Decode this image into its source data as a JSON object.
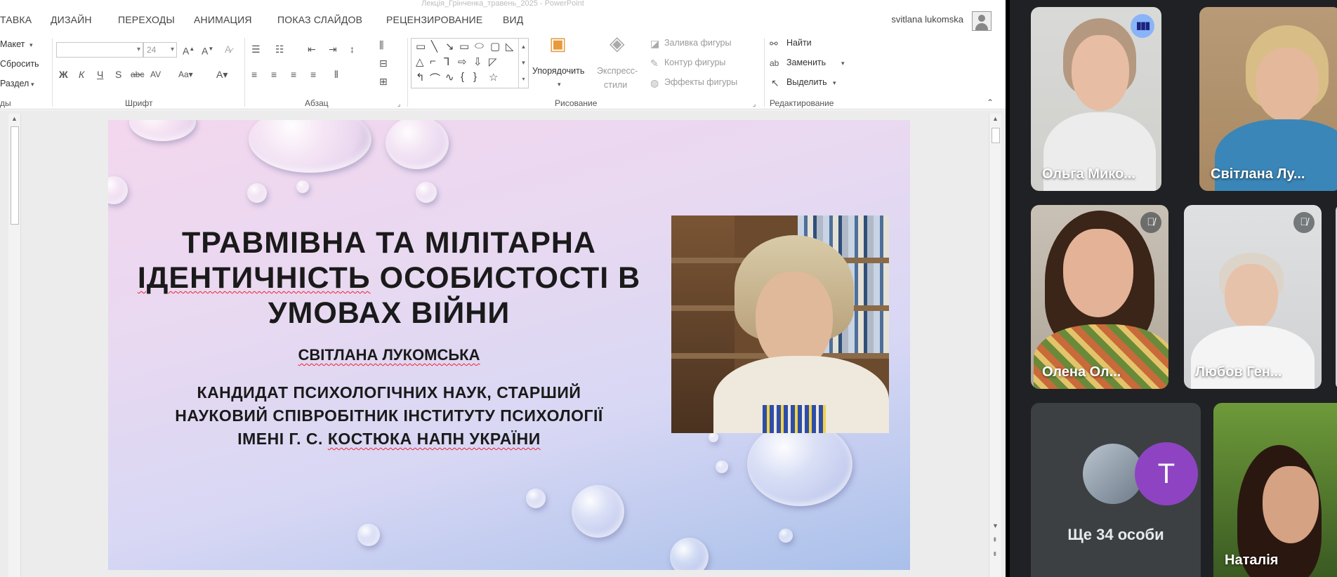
{
  "ppt": {
    "window_title": "Лекція_Грінченка_травень_2025 - PowerPoint",
    "tabs": [
      "ТАВКА",
      "ДИЗАЙН",
      "ПЕРЕХОДЫ",
      "АНИМАЦИЯ",
      "ПОКАЗ СЛАЙДОВ",
      "РЕЦЕНЗИРОВАНИЕ",
      "ВИД"
    ],
    "user_name": "svitlana lukomska",
    "ribbon": {
      "slides_group": {
        "layout": "Макет",
        "reset": "Сбросить",
        "section": "Раздел",
        "label": "ды"
      },
      "font_group": {
        "font_size": "24",
        "label": "Шрифт"
      },
      "paragraph_group": {
        "label": "Абзац"
      },
      "drawing_group": {
        "arrange": "Упорядочить",
        "quick_styles_1": "Экспресс-",
        "quick_styles_2": "стили",
        "fill": "Заливка фигуры",
        "outline": "Контур фигуры",
        "effects": "Эффекты фигуры",
        "label": "Рисование"
      },
      "editing_group": {
        "find": "Найти",
        "replace": "Заменить",
        "select": "Выделить",
        "label": "Редактирование"
      }
    }
  },
  "slide": {
    "title_line1": "ТРАВМІВНА ТА МІЛІТАРНА",
    "title_line2a": "ІДЕНТИЧНІСТЬ",
    "title_line2b": " ОСОБИСТОСТІ В",
    "title_line3": "УМОВАХ ВІЙНИ",
    "author": "СВІТЛАНА ЛУКОМСЬКА",
    "desc_line1": "КАНДИДАТ ПСИХОЛОГІЧНИХ НАУК, СТАРШИЙ",
    "desc_line2": "НАУКОВИЙ СПІВРОБІТНИК ІНСТИТУТУ ПСИХОЛОГІЇ",
    "desc_line3a": "ІМЕНІ Г. С. ",
    "desc_line3b": "КОСТЮКА НАПН УКРАЇНИ"
  },
  "meet": {
    "participants": [
      {
        "name": "Ольга Мико..."
      },
      {
        "name": "Світлана Лу..."
      },
      {
        "name": "Олена Ол..."
      },
      {
        "name": "Любов Ген..."
      },
      {
        "name": "Наталія"
      }
    ],
    "more_avatar_letter": "T",
    "more_label": "Ще 34 особи"
  },
  "colors": {
    "meet_bg": "#202124",
    "speaking_badge": "#8ab4f8",
    "avatar_purple": "#8e44c2"
  }
}
